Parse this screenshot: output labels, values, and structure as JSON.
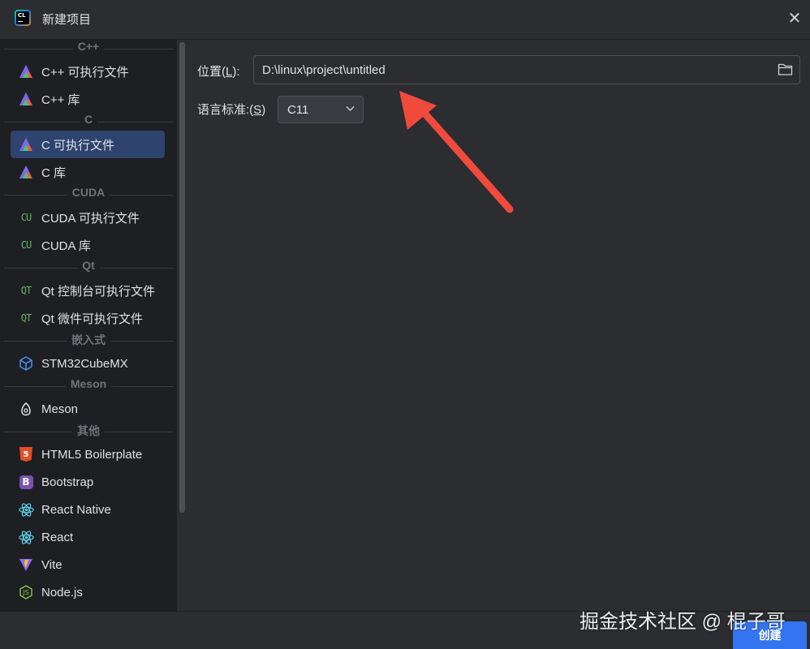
{
  "window": {
    "title": "新建项目",
    "close_glyph": "✕"
  },
  "sidebar": {
    "groups": [
      {
        "header": "C++",
        "items": [
          {
            "label": "C++ 可执行文件",
            "icon": "clion-triangle-icon"
          },
          {
            "label": "C++ 库",
            "icon": "clion-triangle-icon"
          }
        ]
      },
      {
        "header": "C",
        "items": [
          {
            "label": "C 可执行文件",
            "icon": "clion-triangle-icon",
            "selected": true
          },
          {
            "label": "C 库",
            "icon": "clion-triangle-icon"
          }
        ]
      },
      {
        "header": "CUDA",
        "items": [
          {
            "label": "CUDA 可执行文件",
            "icon": "cuda-icon",
            "icon_text": "CU"
          },
          {
            "label": "CUDA 库",
            "icon": "cuda-icon",
            "icon_text": "CU"
          }
        ]
      },
      {
        "header": "Qt",
        "items": [
          {
            "label": "Qt 控制台可执行文件",
            "icon": "qt-icon",
            "icon_text": "QT"
          },
          {
            "label": "Qt 微件可执行文件",
            "icon": "qt-icon",
            "icon_text": "QT"
          }
        ]
      },
      {
        "header": "嵌入式",
        "items": [
          {
            "label": "STM32CubeMX",
            "icon": "cube-icon"
          }
        ]
      },
      {
        "header": "Meson",
        "items": [
          {
            "label": "Meson",
            "icon": "meson-icon"
          }
        ]
      },
      {
        "header": "其他",
        "items": [
          {
            "label": "HTML5 Boilerplate",
            "icon": "html5-icon",
            "icon_text": "5"
          },
          {
            "label": "Bootstrap",
            "icon": "bootstrap-icon",
            "icon_text": "B"
          },
          {
            "label": "React Native",
            "icon": "react-icon"
          },
          {
            "label": "React",
            "icon": "react-icon"
          },
          {
            "label": "Vite",
            "icon": "vite-icon"
          },
          {
            "label": "Node.js",
            "icon": "nodejs-icon",
            "icon_text": "JS"
          }
        ]
      }
    ]
  },
  "form": {
    "location_label": "位置(",
    "location_mnemonic": "L",
    "location_label_end": "):",
    "location_value": "D:\\linux\\project\\untitled",
    "language_label": "语言标准:(",
    "language_mnemonic": "S",
    "language_label_end": ")",
    "language_value": "C11"
  },
  "footer": {
    "create_label": "创建"
  },
  "watermark": "掘金技术社区 @ 棍子哥",
  "colors": {
    "accent": "#3574f0",
    "selected_bg": "#2e436e",
    "annotation_arrow": "#f04a3c"
  }
}
